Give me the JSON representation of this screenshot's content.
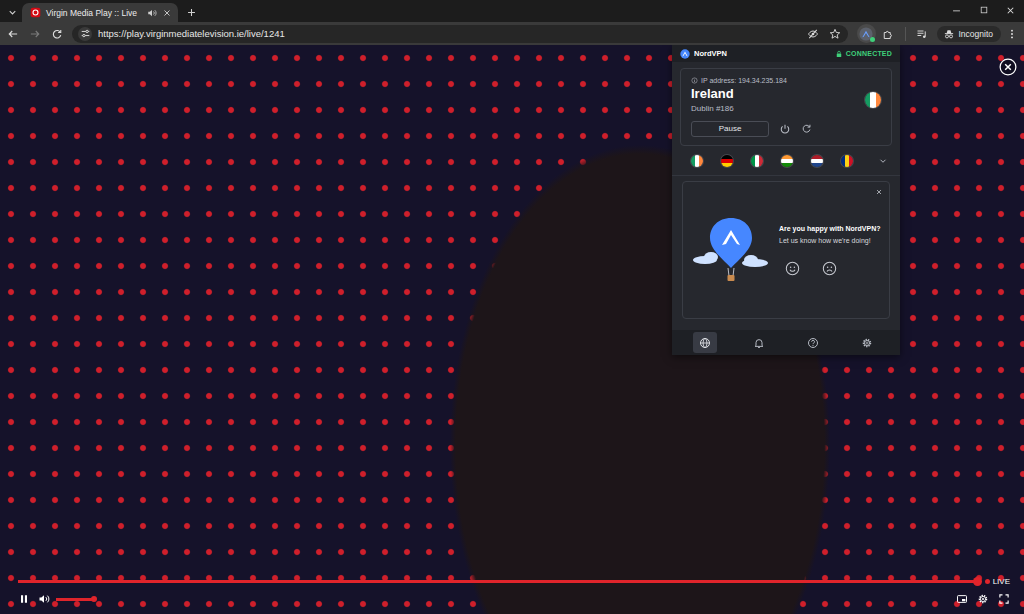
{
  "browser": {
    "tabs": [
      {
        "title": "Virgin Media Play :: Live",
        "selected": true,
        "audio_playing": true
      }
    ],
    "back_disabled": false,
    "forward_disabled": true,
    "address": "https://play.virginmediatelevision.ie/live/1241",
    "bookmarked": false,
    "incognito_label": "Incognito"
  },
  "player": {
    "playing": true,
    "progress": {
      "level": 1
    },
    "live_label": "LIVE",
    "volume": {
      "muted": false,
      "level": 1
    }
  },
  "vpn": {
    "brand": "NordVPN",
    "status": "CONNECTED",
    "connected": true,
    "ip": "IP address: 194.34.235.184",
    "country": "Ireland",
    "server": "Dublin #186",
    "country_flag": {
      "kind": "vertical",
      "colors": [
        "#169b62",
        "#ffffff",
        "#ff883e"
      ]
    },
    "pause_button": "Pause",
    "recent_countries": [
      {
        "kind": "vertical",
        "colors": [
          "#169b62",
          "#ffffff",
          "#ff883e"
        ]
      },
      {
        "kind": "horizontal",
        "colors": [
          "#000000",
          "#dd0000",
          "#ffce00"
        ]
      },
      {
        "kind": "vertical",
        "colors": [
          "#009246",
          "#ffffff",
          "#ce2b37"
        ]
      },
      {
        "kind": "horizontal",
        "colors": [
          "#ff9933",
          "#ffffff",
          "#138808"
        ]
      },
      {
        "kind": "horizontal",
        "colors": [
          "#ae1c28",
          "#ffffff",
          "#21468b"
        ]
      },
      {
        "kind": "vertical",
        "colors": [
          "#002b7f",
          "#fcd116",
          "#ce1126"
        ]
      }
    ],
    "feedback": {
      "title": "Are you happy with NordVPN?",
      "subtitle": "Let us know how we're doing!"
    },
    "nav": [
      {
        "selected": true
      },
      {
        "selected": false
      },
      {
        "selected": false
      },
      {
        "selected": false
      }
    ]
  }
}
